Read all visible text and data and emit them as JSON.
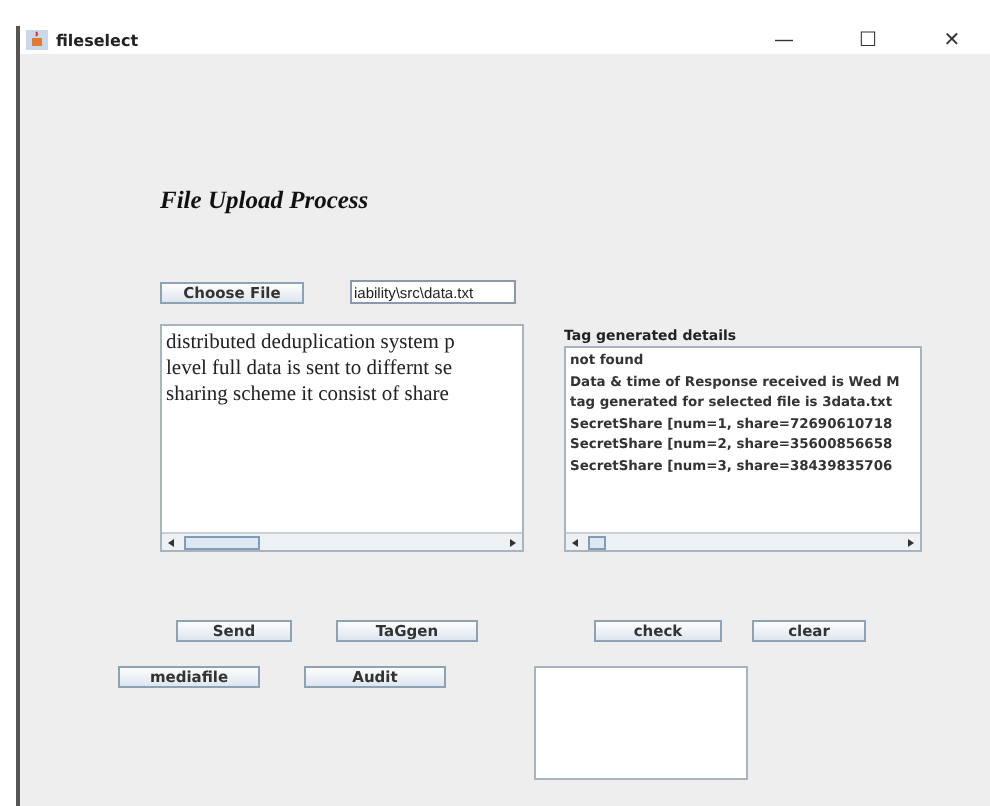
{
  "window": {
    "title": "fileselect",
    "controls": [
      "—",
      "☐",
      "✕"
    ]
  },
  "heading": "File Upload Process",
  "choose_button": "Choose File",
  "file_field": {
    "value": "iability\\src\\data.txt"
  },
  "content_area": {
    "lines": [
      "distributed deduplication system p",
      "level full data is sent to differnt se",
      "sharing scheme it consist of share"
    ]
  },
  "tag_panel": {
    "label": "Tag generated details",
    "lines": [
      "not found",
      "Data & time of Response received is Wed M",
      "tag generated for selected file is 3data.txt",
      "SecretShare [num=1, share=72690610718",
      "SecretShare [num=2, share=35600856658",
      "SecretShare [num=3, share=38439835706"
    ]
  },
  "buttons_row_1": [
    "Send",
    "TaGgen",
    "check",
    "clear"
  ],
  "buttons_row_2": [
    "mediafile",
    "Audit"
  ]
}
